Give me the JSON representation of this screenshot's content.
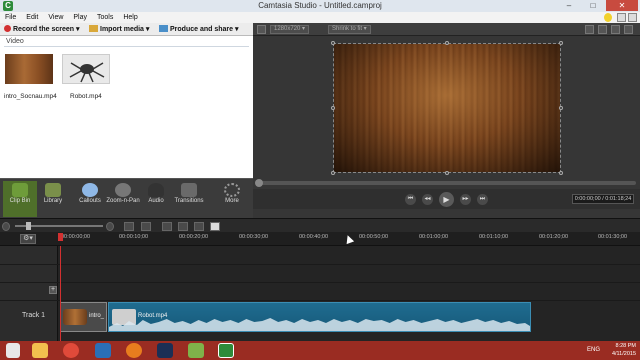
{
  "window": {
    "title": "Camtasia Studio - Untitled.camproj"
  },
  "menu": [
    "File",
    "Edit",
    "View",
    "Play",
    "Tools",
    "Help"
  ],
  "toolbar": {
    "record": "Record the screen",
    "import": "Import media",
    "produce": "Produce and share"
  },
  "clipbin": {
    "section": "Video",
    "items": [
      {
        "label": "intro_Socnau.mp4"
      },
      {
        "label": "Robot.mp4"
      }
    ]
  },
  "preview": {
    "resolution": "1280x720",
    "fit": "Shrink to fit",
    "timecode": "0:00:00;00 / 0:01:18;24"
  },
  "tasks": [
    {
      "label": "Clip Bin",
      "icon": "film-strip-icon",
      "color": "#6e9c3a"
    },
    {
      "label": "Library",
      "icon": "library-icon",
      "color": "#7a8f4a"
    },
    {
      "label": "Callouts",
      "icon": "callout-icon",
      "color": "#8fb8e6"
    },
    {
      "label": "Zoom-n-Pan",
      "icon": "magnifier-icon",
      "color": "#777777"
    },
    {
      "label": "Audio",
      "icon": "microphone-icon",
      "color": "#333333"
    },
    {
      "label": "Transitions",
      "icon": "transitions-icon",
      "color": "#6a6a6a"
    },
    {
      "label": "More",
      "icon": "more-dots-icon",
      "color": "#555555"
    }
  ],
  "ruler": {
    "ticks": [
      "00:00:00;00",
      "00:00:10;00",
      "00:00:20;00",
      "00:00:30;00",
      "00:00:40;00",
      "00:00:50;00",
      "00:01:00;00",
      "00:01:10;00",
      "00:01:20;00",
      "00:01:30;00"
    ]
  },
  "tracks": {
    "track1_label": "Track 1",
    "clips": [
      {
        "name": "intro_"
      },
      {
        "name": "Robot.mp4"
      }
    ]
  },
  "taskbar": {
    "lang": "ENG",
    "time": "8:28 PM",
    "date": "4/11/2015"
  }
}
